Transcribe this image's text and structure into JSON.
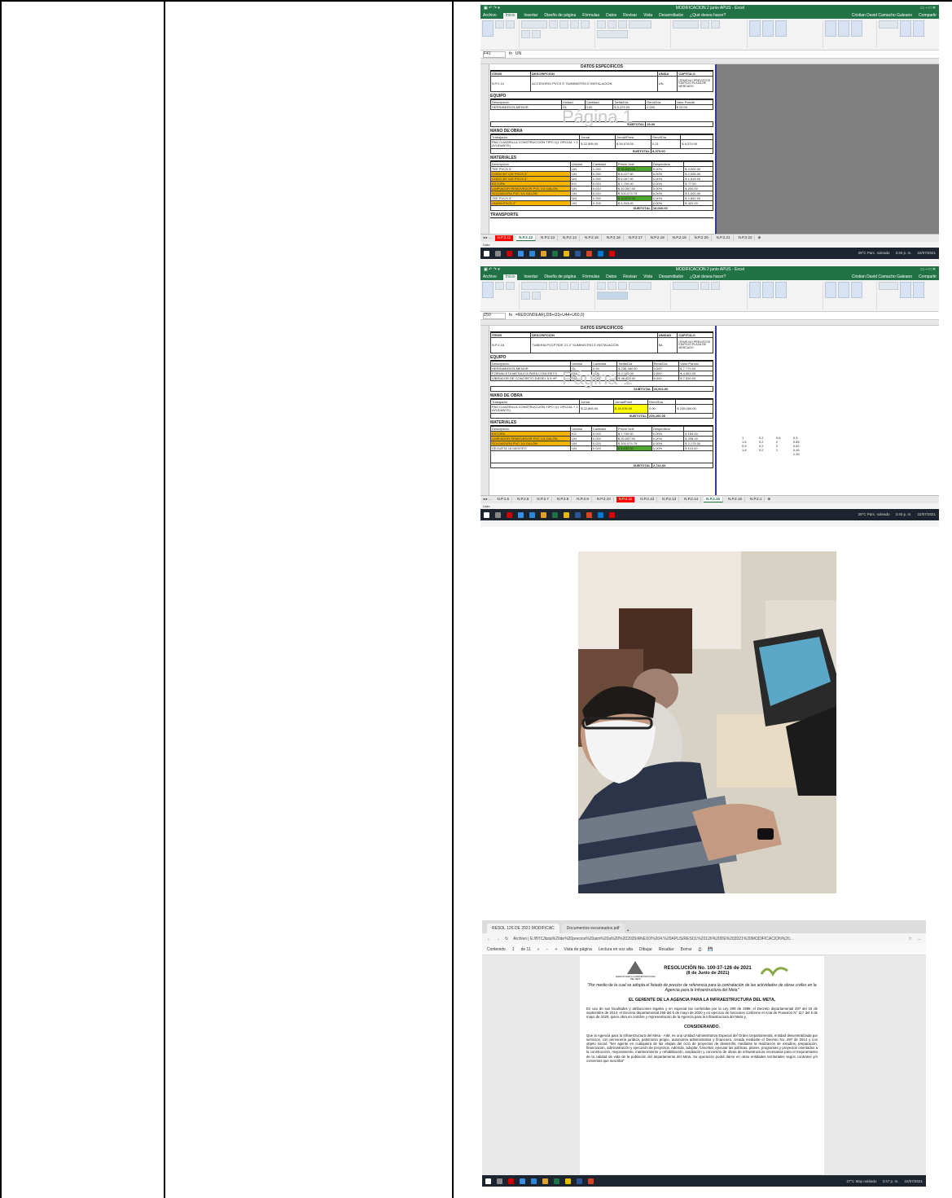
{
  "excel1": {
    "title": "MODIFICACION 2 junio APUS - Excel",
    "user": "Cristian David Camacho Galeano",
    "share": "Compartir",
    "menu": [
      "Archivo",
      "Inicio",
      "Insertar",
      "Diseño de página",
      "Fórmulas",
      "Datos",
      "Revisar",
      "Vista",
      "Desarrollador",
      "¿Qué desea hacer?"
    ],
    "cell_ref": "F41",
    "formula": "UN",
    "sheet_header": "DATOS ESPECIFICOS",
    "col_items": "ITEMS",
    "col_desc": "DESCRIPCION",
    "col_unit": "UNIDA",
    "col_chapter": "CAPITULO",
    "item_code": "N.P.2.12",
    "item_desc": "ACCESORIO PVCS 3\" SUMINISTRO E INSTALACIÓN",
    "item_unit": "UN",
    "item_chapter": "ITEMS NO PREVISTOS EDIFICIO PLAZA DE MERCADO",
    "sec_equipo": "EQUIPO",
    "eq_headers": [
      "Descripción",
      "Unidad",
      "Cantidad",
      "Tarifa/Día",
      "Rend/Día",
      "Valor Parcial"
    ],
    "eq_rows": [
      [
        "HERRAMIENTA MENOR",
        "GL",
        "0.50",
        "$ 5,379.00",
        "0.000",
        "$ 29.00"
      ]
    ],
    "watermark": "Página 1",
    "subtotal_label": "SUBTOTAL",
    "eq_subtotal": "29.00",
    "sec_mano": "MANO DE OBRA",
    "mo_headers": [
      "Trabajador",
      "Jornal",
      "Jornal/Prest",
      "Rend/Día"
    ],
    "mo_rows": [
      [
        "PAG CUADRILLA CONSTRUCCIÓN TIPO 1(1 OFICIAL + 1 AYUDANTE)",
        "$ 22,895.00",
        "$ 39,078.00",
        "0.21",
        "$ 8,379.00"
      ]
    ],
    "mo_subtotal": "8,379.00",
    "sec_mat": "MATERIALES",
    "mat_headers": [
      "Descripción",
      "Unidad",
      "Cantidad",
      "Precio Unit",
      "Desperdicio"
    ],
    "mat_rows": [
      [
        "TEE PVCS 3\"",
        "UN",
        "0.250",
        "$ 16,000.00",
        "0.00%",
        "$ 4,000.00"
      ],
      [
        "CODO 90° C/E PVCS 3\"",
        "UN",
        "0.250",
        "$ 8,027.50",
        "0.00%",
        "$ 2,006.00"
      ],
      [
        "CODO 45° C/E PVCS 3\"",
        "UN",
        "0.250",
        "$ 6,067.50",
        "0.00%",
        "$ 1,516.00"
      ],
      [
        "ESTOPA",
        "KG",
        "0.010",
        "$ 7,700.00",
        "0.00%",
        "$ 77.00"
      ],
      [
        "LIMPIADOR REMOVEDOR PVC 1/4 GALÓN",
        "UN",
        "0.010",
        "$ 20,057.50",
        "0.00%",
        "$ 200.00"
      ],
      [
        "SOLDADURA PVC 1/4 GALÓN",
        "UN",
        "0.010",
        "$ 100,074.75",
        "0.00%",
        "$ 1,000.00"
      ],
      [
        "TEE PVCS 3\"",
        "UN",
        "0.250",
        "$ 11,570.00",
        "0.00%",
        "$ 2,892.00"
      ],
      [
        "UNION PVCS 3\"",
        "UN",
        "0.100",
        "$ 4,203.00",
        "0.00%",
        "$ 420.00"
      ]
    ],
    "mat_subtotal": "16,000.00",
    "sec_trans": "TRANSPORTE",
    "sheet_tabs": [
      "N.P.2.11",
      "N.P.2.12",
      "N.P.2.13",
      "N.P.2.14",
      "N.P.2.15",
      "N.P.2.16",
      "N.P.2.17",
      "N.P.2.18",
      "N.P.2.19",
      "N.P.2.20",
      "N.P.2.21",
      "N.P.2.22"
    ],
    "status": "Listo",
    "weather": "29°C Parc. soleado",
    "time": "3:40 p. m.",
    "date": "22/07/2021"
  },
  "excel2": {
    "title": "MODIFICACION 2 junio APUS - Excel",
    "user": "Cristian David Camacho Galeano",
    "cell_ref": "Z50",
    "formula": "=REDONDEAR(J28+I33+U44+U60,0)",
    "sheet_header": "DATOS ESPECIFICOS",
    "col_items": "ITEMS",
    "col_desc": "DESCRIPCION",
    "col_unit": "UNIDAD",
    "col_chapter": "CAPITULO",
    "item_code": "N.P.2.16",
    "item_desc": "TUBERIA PVCP RDE 21 2\" SUMINISTRO E INSTALACIÓN",
    "item_unit": "ML",
    "item_chapter": "ITEMS NO PREVISTOS EDIFICIO PLAZA DE MERCADO",
    "sec_equipo": "EQUIPO",
    "eq_rows": [
      [
        "HERRAMIENTA MENOR",
        "GL",
        "0.50",
        "$ 236,380.00",
        "0.000",
        "$ 7,779.00"
      ],
      [
        "FORMALETA METALICA PARA CONCRETO",
        "DÍA",
        "1.00",
        "$ 2,230.00",
        "2.000",
        "$ 4,563.00"
      ],
      [
        "VIBRADOR DE CONCRETO DIESEL 5.5 HP",
        "DÍA",
        "1.00",
        "$ 46,603.00",
        "6.000",
        "$ 7,539.00"
      ]
    ],
    "watermark": "Página 1",
    "subtotal_label": "SUBTOTAL",
    "eq_subtotal": "23,901.00",
    "sec_mano": "MANO DE OBRA",
    "mo_rows": [
      [
        "PAG CUADRILLA CONSTRUCCIÓN TIPO 1(1 OFICIAL + 1 AYUDANTE)",
        "$ 22,895.00",
        "$ 39,078.00",
        "0.00",
        "$ 239,260.00"
      ]
    ],
    "mo_subtotal": "239,260.00",
    "sec_mat": "MATERIALES",
    "mat_rows": [
      [
        "ESTOPA",
        "KG",
        "0.020",
        "$ 7,700.00",
        "0.00%",
        "$ 154.00"
      ],
      [
        "LIMPIADOR REMOVEDOR PVC 1/4 GALÓN",
        "UN",
        "0.020",
        "$ 20,057.50",
        "0.00%",
        "$ 298.00"
      ],
      [
        "SOLDADURA PVC 1/4 GALÓN",
        "UN",
        "0.020",
        "$ 100,074.75",
        "0.00%",
        "$ 2,175.00"
      ],
      [
        "SEGUETA 18 DIENTES",
        "UN",
        "0.020",
        "$ 8,830.00",
        "0.00%",
        "$ 115.00"
      ]
    ],
    "mat_subtotal": "2,742.00",
    "side_values": [
      [
        "1",
        "0.2",
        "0.6",
        "0.3"
      ],
      [
        "1.6",
        "0.2",
        "2",
        "0.65"
      ],
      [
        "0.6",
        "0.2",
        "2",
        "0.52"
      ],
      [
        "1.6",
        "0.2",
        "1",
        "0.16"
      ],
      [
        "",
        "",
        "",
        "1.25"
      ]
    ],
    "sheet_tabs": [
      "N.P.1.6",
      "N.P.2.6",
      "N.P.2.7",
      "N.P.2.8",
      "N.P.2.9",
      "N.P.2.10",
      "N.P.2.11",
      "N.P.2.12",
      "N.P.2.13",
      "N.P.2.14",
      "N.P.2.15",
      "N.P.2.16",
      "N.P.2.1"
    ],
    "status": "Listo",
    "weather": "29°C Parc. soleado",
    "time": "3:40 p. m.",
    "date": "22/07/2021"
  },
  "pdf": {
    "tab1": "RESOL 126 DE 2021 MODIFICAC",
    "tab2": "Documentos escaneados.pdf",
    "url": "Archivo | E:/BYC/lista%20de%20precios%20aim%20a%20%202020/ANEXO%204.%20APUS/RESOL%20126%20DE%202021%20MODIFICACION%20...",
    "tools": [
      "Contenido",
      "1",
      "de 11",
      "Vista de página",
      "Lectura en voz alta",
      "Dibujar",
      "Resaltar",
      "Borrar"
    ],
    "resolution_title": "RESOLUCIÓN No. 100-37-126 de 2021",
    "resolution_date": "(8 de Junio de 2021)",
    "logo_text": "AGENCIA PARA LA INFRAESTRUCTURA DEL META",
    "quote": "\"Por medio de la cual se adopta el listado de precios de referencia para la contratación de las actividades de obras civiles en la Agencia para la Infraestructura del Meta\"",
    "heading": "EL GERENTE DE LA AGENCIA PARA LA INFRAESTRUCTURA DEL META,",
    "para1": "En uso de sus facultades y atribuciones legales y en especial las conferidas por la Ley 489 de 1998, el Decreto departamental 297 del 15 de septiembre de 2014, el Decreto departamental 259 del 5 de mayo de 2020 y en ejercicio de funciones conforme el Acta de Posesión N° 117 del 5 de mayo de 2020, quien obra en nombre y representación de la Agencia para la Infraestructura del Meta y,",
    "considerando": "CONSIDERANDO.",
    "para2": "Que la Agencia para la Infraestructura del Meta - AIM, es una Unidad Administrativa Especial del Orden Departamental, entidad descentralizada por servicios, con personería jurídica, patrimonio propio, autonomía administrativa y financiera, creada mediante el Decreto No. 297 de 2014 y con objeto social: \"Ser agente en cualquiera de las etapas del ciclo de proyectos de desarrollo, mediante la realización de estudios, preparación, financiación, administración y ejecución de proyectos. Además, adoptar, fomentar, ejecutar las políticas, planes, programas y proyectos orientados a la construcción, mejoramiento, mantenimiento y rehabilitación, ampliación y concesión de obras de infraestructura necesarias para el mejoramiento de la calidad de vida de la población del departamento del Meta. Su operación podrá darse en otras entidades territoriales según contratos y/o convenios que suscriba\"",
    "weather": "27°C May nublado",
    "time": "3:47 p. m.",
    "date": "22/07/2021"
  },
  "colors": {
    "excel_green": "#217346",
    "highlight_orange": "#f5b400",
    "highlight_red": "#ff0000",
    "taskbar": "#1c2430"
  }
}
